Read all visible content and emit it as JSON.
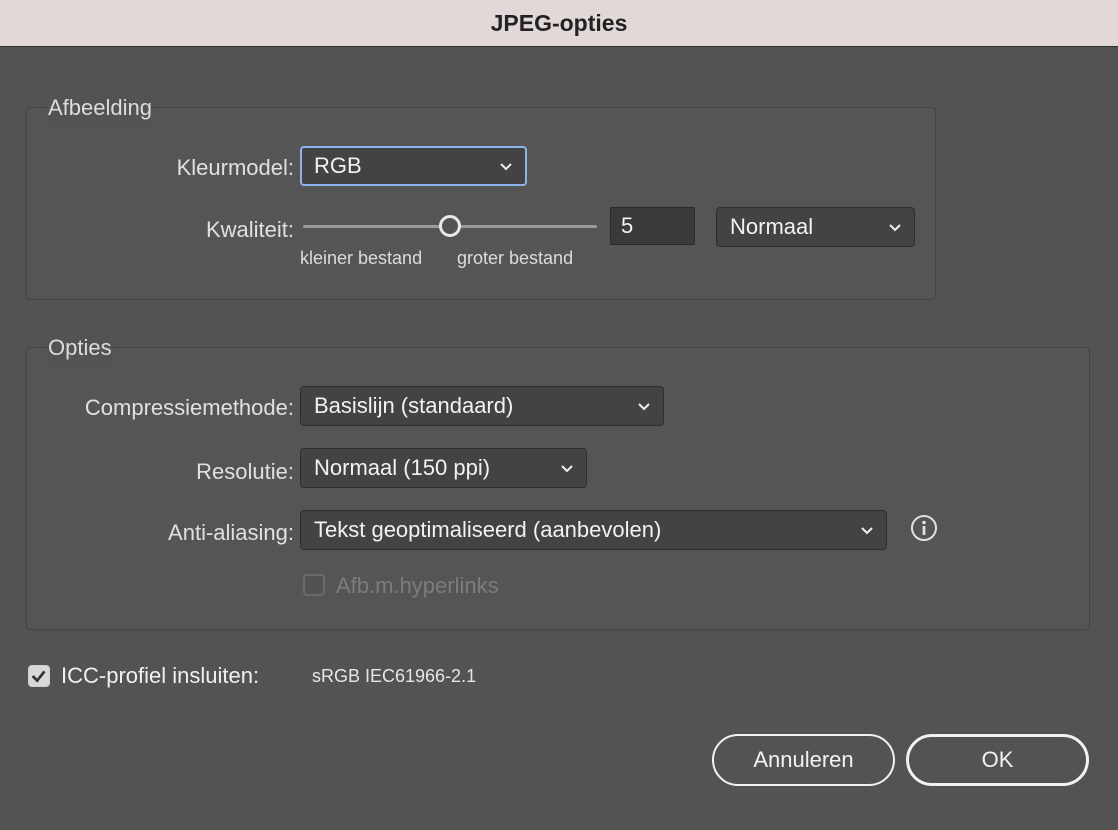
{
  "window": {
    "title": "JPEG-opties"
  },
  "image_group": {
    "title": "Afbeelding",
    "color_model": {
      "label": "Kleurmodel:",
      "value": "RGB"
    },
    "quality": {
      "label": "Kwaliteit:",
      "slider_value": 5,
      "slider_min": 0,
      "slider_max": 10,
      "value": "5",
      "preset": "Normaal",
      "min_caption": "kleiner bestand",
      "max_caption": "groter bestand"
    }
  },
  "options_group": {
    "title": "Opties",
    "compression": {
      "label": "Compressiemethode:",
      "value": "Basislijn (standaard)"
    },
    "resolution": {
      "label": "Resolutie:",
      "value": "Normaal (150 ppi)"
    },
    "anti_aliasing": {
      "label": "Anti-aliasing:",
      "value": "Tekst geoptimaliseerd (aanbevolen)"
    },
    "hyperlinks": {
      "label": "Afb.m.hyperlinks",
      "checked": false,
      "enabled": false
    }
  },
  "icc": {
    "label": "ICC-profiel insluiten:",
    "profile": "sRGB IEC61966-2.1",
    "checked": true
  },
  "buttons": {
    "cancel": "Annuleren",
    "ok": "OK"
  },
  "icons": {
    "dropdown": "chevron-down-icon",
    "info": "info-icon",
    "check": "checkmark-icon"
  },
  "colors": {
    "background": "#535353",
    "titlebar": "#e2d8d8",
    "focus_ring": "#8fb3ee"
  }
}
